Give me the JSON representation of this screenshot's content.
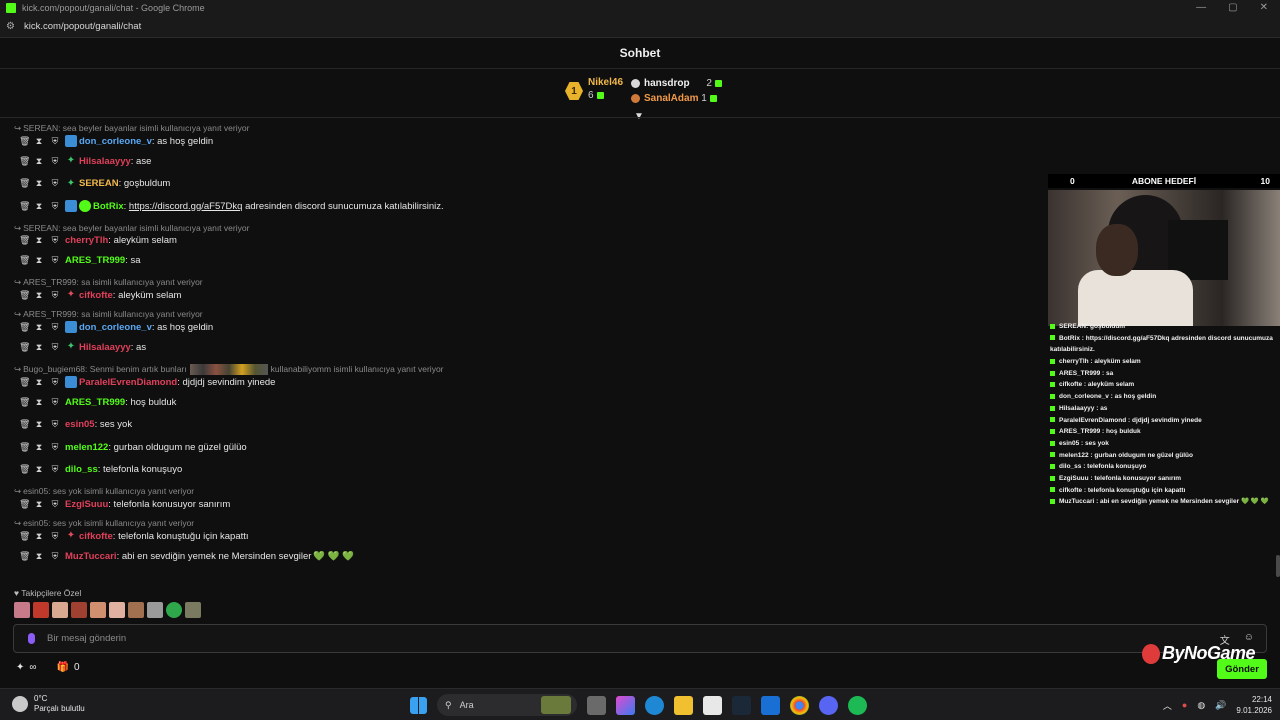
{
  "window": {
    "title": "kick.com/popout/ganali/chat - Google Chrome",
    "url": "kick.com/popout/ganali/chat"
  },
  "chat": {
    "title": "Sohbet",
    "leaderboard": {
      "first": {
        "rank": "1",
        "name": "Nikel46",
        "value": "6"
      },
      "second": {
        "name": "hansdrop",
        "value": "2"
      },
      "third": {
        "name": "SanalAdam",
        "value": "1"
      }
    },
    "messages": [
      {
        "reply": "SEREAN: sea beyler bayanlar isimli kullanıcıya yanıt veriyor",
        "user": "don_corleone_v",
        "color": "#5aa8f2",
        "badge": "blue",
        "text": ": as hoş geldin"
      },
      {
        "reply": "",
        "user": "Hilsalaayyy",
        "color": "#e0405a",
        "badge": "green",
        "text": ": ase"
      },
      {
        "reply": "",
        "user": "SEREAN",
        "color": "#f2b94a",
        "badge": "green",
        "text": ": goşbuldum"
      },
      {
        "reply": "",
        "user": "BotRix",
        "color": "#53fc18",
        "badge": "bot",
        "text": ": ",
        "link": "https://discord.gg/aF57Dkq",
        "after": " adresinden discord sunucumuza katılabilirsiniz."
      },
      {
        "reply": "SEREAN: sea beyler bayanlar isimli kullanıcıya yanıt veriyor",
        "user": "cherryTlh",
        "color": "#e0405a",
        "badge": "none",
        "text": ": aleyküm selam"
      },
      {
        "reply": "",
        "user": "ARES_TR999",
        "color": "#53fc18",
        "badge": "none",
        "text": ": sa"
      },
      {
        "reply": "ARES_TR999: sa isimli kullanıcıya yanıt veriyor",
        "user": "cifkofte",
        "color": "#e0405a",
        "badge": "red",
        "text": ": aleyküm selam"
      },
      {
        "reply": "ARES_TR999: sa isimli kullanıcıya yanıt veriyor",
        "user": "don_corleone_v",
        "color": "#5aa8f2",
        "badge": "blue",
        "text": ": as hoş geldin"
      },
      {
        "reply": "",
        "user": "Hilsalaayyy",
        "color": "#e0405a",
        "badge": "green",
        "text": ": as"
      },
      {
        "reply": "Bugo_bugiem68: Senmi benim artık bunları",
        "reply_after": "kullanabiliyomm isimli kullanıcıya yanıt veriyor",
        "user": "ParalelEvrenDiamond",
        "color": "#e0405a",
        "badge": "blue-small",
        "text": ": djdjdj sevindim yinede"
      },
      {
        "reply": "",
        "user": "ARES_TR999",
        "color": "#53fc18",
        "badge": "none",
        "text": ": hoş bulduk"
      },
      {
        "reply": "",
        "user": "esin05",
        "color": "#e0405a",
        "badge": "none",
        "text": ": ses yok"
      },
      {
        "reply": "",
        "user": "melen122",
        "color": "#53fc18",
        "badge": "none",
        "text": ": gurban oldugum ne güzel gülüo"
      },
      {
        "reply": "",
        "user": "dilo_ss",
        "color": "#53fc18",
        "badge": "none",
        "text": ": telefonla konuşuyo"
      },
      {
        "reply": "esin05: ses yok isimli kullanıcıya yanıt veriyor",
        "user": "EzgiSuuu",
        "color": "#e0405a",
        "badge": "none",
        "text": ": telefonla konusuyor sanırım"
      },
      {
        "reply": "esin05: ses yok isimli kullanıcıya yanıt veriyor",
        "user": "cifkofte",
        "color": "#e0405a",
        "badge": "red",
        "text": ": telefonla konuştuğu için kapattı"
      },
      {
        "reply": "",
        "user": "MuzTuccari",
        "color": "#e0405a",
        "badge": "none",
        "text": ": abi en sevdiğin yemek ne Mersinden sevgiler",
        "hearts": "💚 💚 💚"
      }
    ],
    "followers_label": "Takipçilere Özel",
    "input_placeholder": "Bir mesaj gönderin",
    "points": "∞",
    "gifts_count": "0",
    "send_label": "Gönder"
  },
  "overlay": {
    "sub_goal_title": "ABONE HEDEFİ",
    "sub_goal_current": "0",
    "sub_goal_target": "10",
    "logo_text": "ByNoGame",
    "mini_chat": [
      "SEREAN: goşbuldum",
      "BotRix : https://discord.gg/aF57Dkq adresinden discord sunucumuza",
      "katılabilirsiniz.",
      "cherryTlh : aleyküm selam",
      "ARES_TR999 : sa",
      "cifkofte : aleyküm selam",
      "don_corleone_v : as hoş geldin",
      "Hilsalaayyy : as",
      "ParalelEvrenDiamond : djdjdj sevindim yinede",
      "ARES_TR999 : hoş bulduk",
      "esin05 : ses yok",
      "melen122 : gurban oldugum ne güzel gülüo",
      "dilo_ss : telefonla konuşuyo",
      "EzgiSuuu : telefonla konusuyor sanırım",
      "cifkofte : telefonla konuştuğu için kapattı",
      "MuzTuccari : abi en sevdiğin yemek ne Mersinden sevgiler 💚 💚 💚"
    ]
  },
  "taskbar": {
    "weather_temp": "0°C",
    "weather_desc": "Parçalı bulutlu",
    "search_label": "Ara",
    "time": "22:14",
    "date": "9.01.2026"
  }
}
